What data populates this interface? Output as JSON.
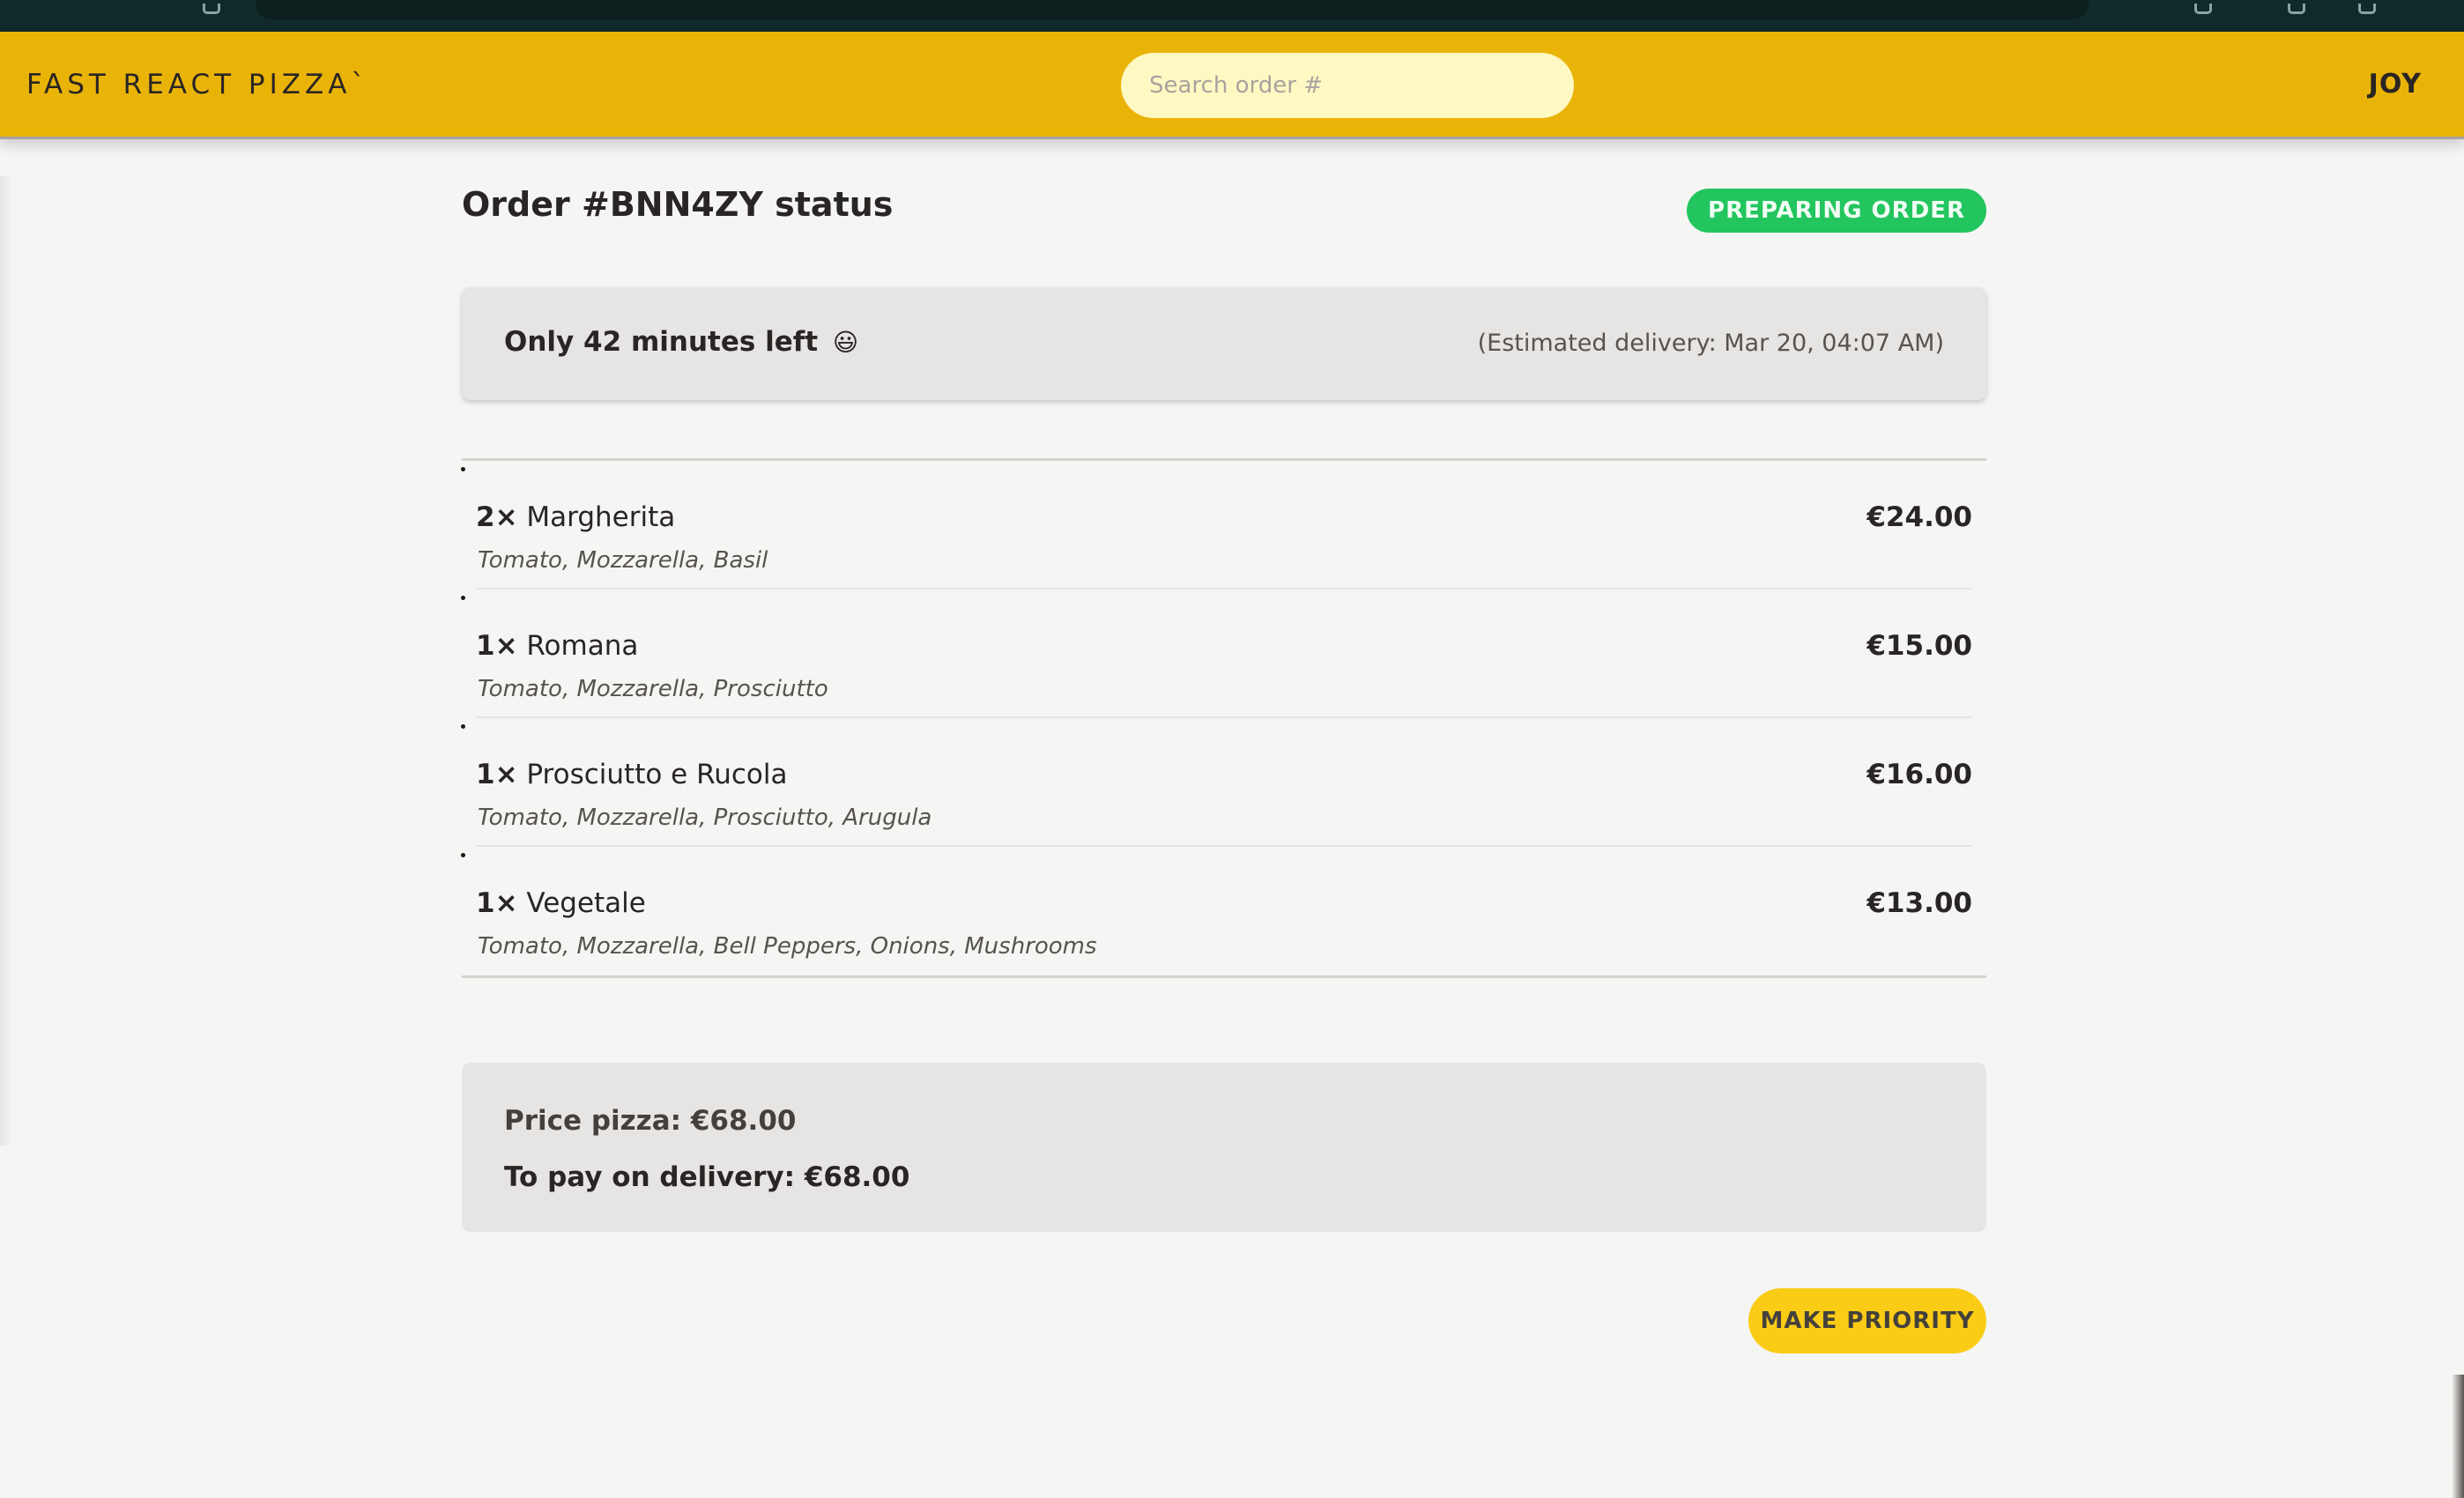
{
  "header": {
    "logo": "Fast React Pizza`",
    "search_placeholder": "Search order #",
    "username": "JOY"
  },
  "order": {
    "title": "Order #BNN4ZY status",
    "status": "PREPARING ORDER",
    "eta": {
      "minutes_left_text": "Only 42 minutes left",
      "emoji": "😃",
      "estimated_delivery": "(Estimated delivery: Mar 20, 04:07 AM)"
    },
    "items": [
      {
        "quantity": "2×",
        "name": "Margherita",
        "ingredients": "Tomato, Mozzarella, Basil",
        "price": "€24.00"
      },
      {
        "quantity": "1×",
        "name": "Romana",
        "ingredients": "Tomato, Mozzarella, Prosciutto",
        "price": "€15.00"
      },
      {
        "quantity": "1×",
        "name": "Prosciutto e Rucola",
        "ingredients": "Tomato, Mozzarella, Prosciutto, Arugula",
        "price": "€16.00"
      },
      {
        "quantity": "1×",
        "name": "Vegetale",
        "ingredients": "Tomato, Mozzarella, Bell Peppers, Onions, Mushrooms",
        "price": "€13.00"
      }
    ],
    "price_pizza": "Price pizza: €68.00",
    "to_pay": "To pay on delivery: €68.00",
    "make_priority_label": "MAKE PRIORITY"
  },
  "colors": {
    "header_bg": "#eab308",
    "status_badge": "#22c55e",
    "priority_button": "#facc15",
    "page_bg": "#f5f5f4"
  }
}
